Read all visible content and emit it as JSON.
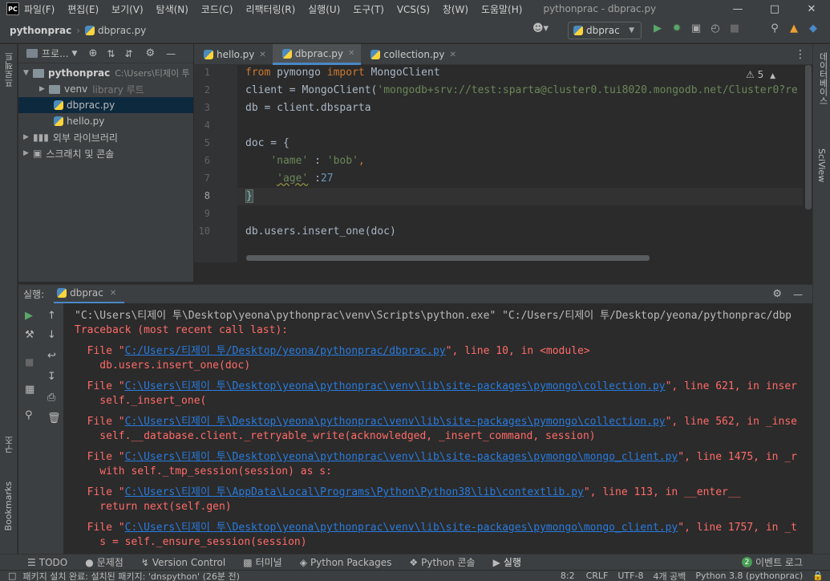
{
  "titlebar": {
    "logo": "PC",
    "menu": [
      "파일(F)",
      "편집(E)",
      "보기(V)",
      "탐색(N)",
      "코드(C)",
      "리팩터링(R)",
      "실행(U)",
      "도구(T)",
      "VCS(S)",
      "창(W)",
      "도움말(H)"
    ],
    "window_title": "pythonprac - dbprac.py"
  },
  "navbar": {
    "project": "pythonprac",
    "file": "dbprac.py",
    "run_config": "dbprac"
  },
  "project_panel": {
    "title": "프로...",
    "left_stripe_label": "프로젝트",
    "tree": [
      {
        "name": "pythonprac",
        "hint": "C:\\Users\\티제이 투",
        "level": 0
      },
      {
        "name": "venv",
        "hint": "library 루트",
        "level": 1
      },
      {
        "name": "dbprac.py",
        "hint": "",
        "level": 1
      },
      {
        "name": "hello.py",
        "hint": "",
        "level": 1
      },
      {
        "name": "외부 라이브러리",
        "hint": "",
        "level": 0
      },
      {
        "name": "스크래치 및 콘솔",
        "hint": "",
        "level": 0
      }
    ]
  },
  "editor": {
    "tabs": [
      "hello.py",
      "dbprac.py",
      "collection.py"
    ],
    "active_tab": "dbprac.py",
    "warnings": "5",
    "line_numbers": [
      "1",
      "2",
      "3",
      "4",
      "5",
      "6",
      "7",
      "8",
      "9",
      "10"
    ],
    "code": {
      "l1_kw": "from",
      "l1_a": " pymongo ",
      "l1_kw2": "import",
      "l1_b": " MongoClient",
      "l2_a": "client = MongoClient(",
      "l2_str": "'mongodb+srv://test:sparta@cluster0.tui8020.mongodb.net/Cluster0?re",
      "l3": "db = client.dbsparta",
      "l5": "doc = {",
      "l6_str": "'name'",
      "l6_a": " : ",
      "l6_str2": "'bob'",
      "l6_b": ",",
      "l7_str": "'age'",
      "l7_a": " :",
      "l7_num": "27",
      "l8": "}",
      "l10": "db.users.insert_one(doc)"
    }
  },
  "right_stripe": [
    "데이터베이스",
    "SciView"
  ],
  "run_panel": {
    "label": "실행:",
    "tab": "dbprac",
    "lines": {
      "cmd": "\"C:\\Users\\티제이 투\\Desktop\\yeona\\pythonprac\\venv\\Scripts\\python.exe\" \"C:/Users/티제이 투/Desktop/yeona/pythonprac/dbp",
      "tb": "Traceback (most recent call last):",
      "f1_pre": "  File \"",
      "f1_link": "C:/Users/티제이 투/Desktop/yeona/pythonprac/dbprac.py",
      "f1_post": "\", line 10, in <module>",
      "c1": "    db.users.insert_one(doc)",
      "f2_pre": "  File \"",
      "f2_link": "C:\\Users\\티제이 투\\Desktop\\yeona\\pythonprac\\venv\\lib\\site-packages\\pymongo\\collection.py",
      "f2_post": "\", line 621, in inser",
      "c2": "    self._insert_one(",
      "f3_pre": "  File \"",
      "f3_link": "C:\\Users\\티제이 투\\Desktop\\yeona\\pythonprac\\venv\\lib\\site-packages\\pymongo\\collection.py",
      "f3_post": "\", line 562, in _inse",
      "c3": "    self.__database.client._retryable_write(acknowledged, _insert_command, session)",
      "f4_pre": "  File \"",
      "f4_link": "C:\\Users\\티제이 투\\Desktop\\yeona\\pythonprac\\venv\\lib\\site-packages\\pymongo\\mongo_client.py",
      "f4_post": "\", line 1475, in _r",
      "c4": "    with self._tmp_session(session) as s:",
      "f5_pre": "  File \"",
      "f5_link": "C:\\Users\\티제이 투\\AppData\\Local\\Programs\\Python\\Python38\\lib\\contextlib.py",
      "f5_post": "\", line 113, in __enter__",
      "c5": "    return next(self.gen)",
      "f6_pre": "  File \"",
      "f6_link": "C:\\Users\\티제이 투\\Desktop\\yeona\\pythonprac\\venv\\lib\\site-packages\\pymongo\\mongo_client.py",
      "f6_post": "\", line 1757, in _t",
      "c6": "    s = self._ensure_session(session)"
    }
  },
  "left_stripe_bottom": [
    "구조",
    "Bookmarks"
  ],
  "bottom_tabs": [
    "TODO",
    "문제점",
    "Version Control",
    "터미널",
    "Python Packages",
    "Python 콘솔",
    "실행"
  ],
  "event_log": {
    "count": "2",
    "label": "이벤트 로그"
  },
  "status": {
    "message": "패키지 설치 완료: 설치된 패키지: 'dnspython' (26분 전)",
    "position": "8:2",
    "line_sep": "CRLF",
    "encoding": "UTF-8",
    "indent": "4개 공백",
    "interpreter": "Python 3.8 (pythonprac)"
  }
}
